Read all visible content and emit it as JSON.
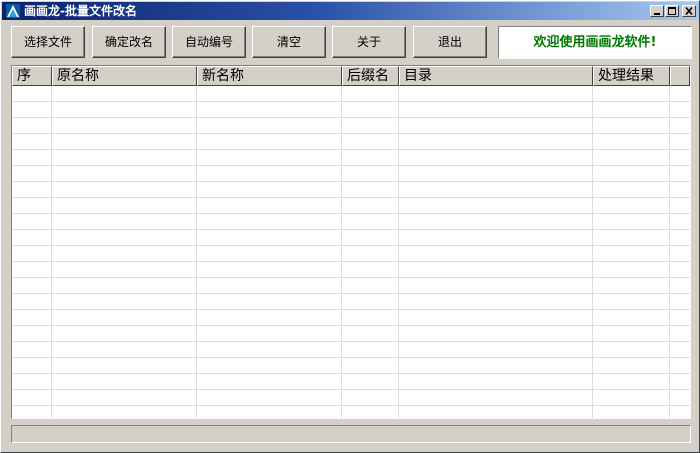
{
  "window": {
    "title": "画画龙-批量文件改名"
  },
  "toolbar": {
    "select_files": "选择文件",
    "confirm_rename": "确定改名",
    "auto_number": "自动编号",
    "clear": "清空",
    "about": "关于",
    "exit": "退出"
  },
  "welcome_text": "欢迎使用画画龙软件!",
  "table": {
    "columns": [
      "序",
      "原名称",
      "新名称",
      "后缀名",
      "目录",
      "处理结果",
      ""
    ],
    "rows": []
  },
  "status": {
    "text": ""
  },
  "colors": {
    "title_gradient_start": "#0a246a",
    "title_gradient_end": "#a6caf0",
    "welcome_text": "#007800",
    "face": "#d4d0c8"
  },
  "icons": [
    "app-logo-icon",
    "minimize-icon",
    "maximize-icon",
    "close-icon"
  ]
}
